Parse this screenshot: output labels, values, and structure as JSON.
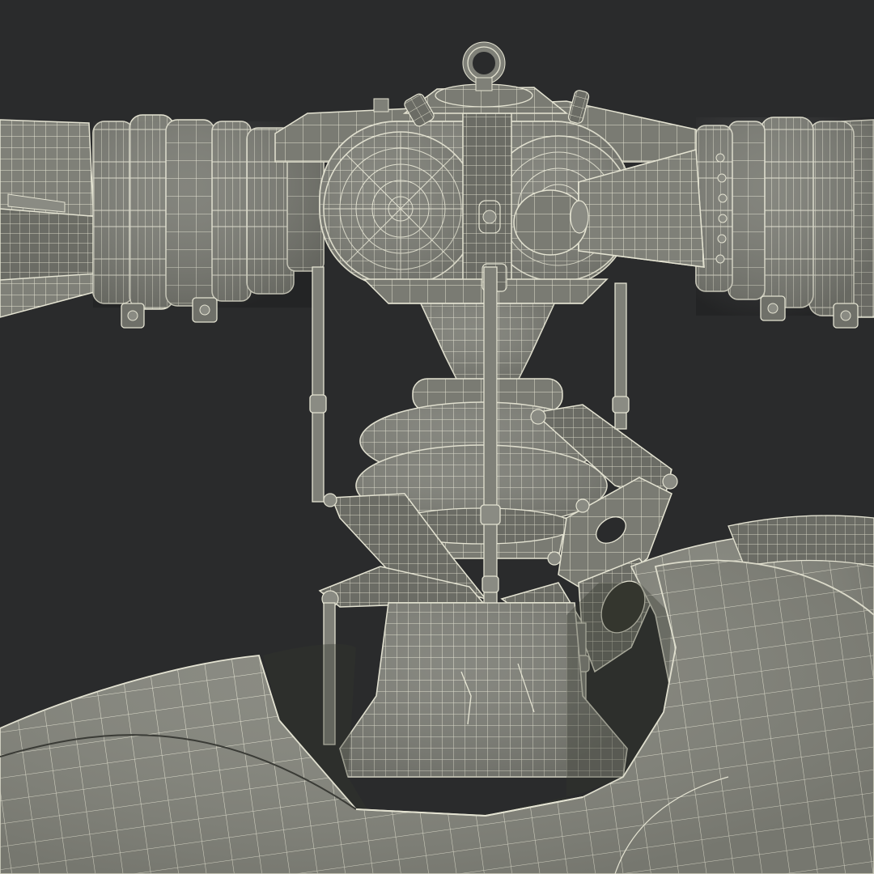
{
  "image": {
    "subject": "helicopter-main-rotor-hub-wireframe",
    "render_style": "wireframe-over-shaded-mesh"
  },
  "colors": {
    "background": "#2a2b2c",
    "mesh_fill": "#7f8078",
    "mesh_fill_dark": "#6b6c65",
    "mesh_fill_light": "#8e8f86",
    "wire": "#e4e3d2",
    "shadow": "#3a3b36"
  }
}
